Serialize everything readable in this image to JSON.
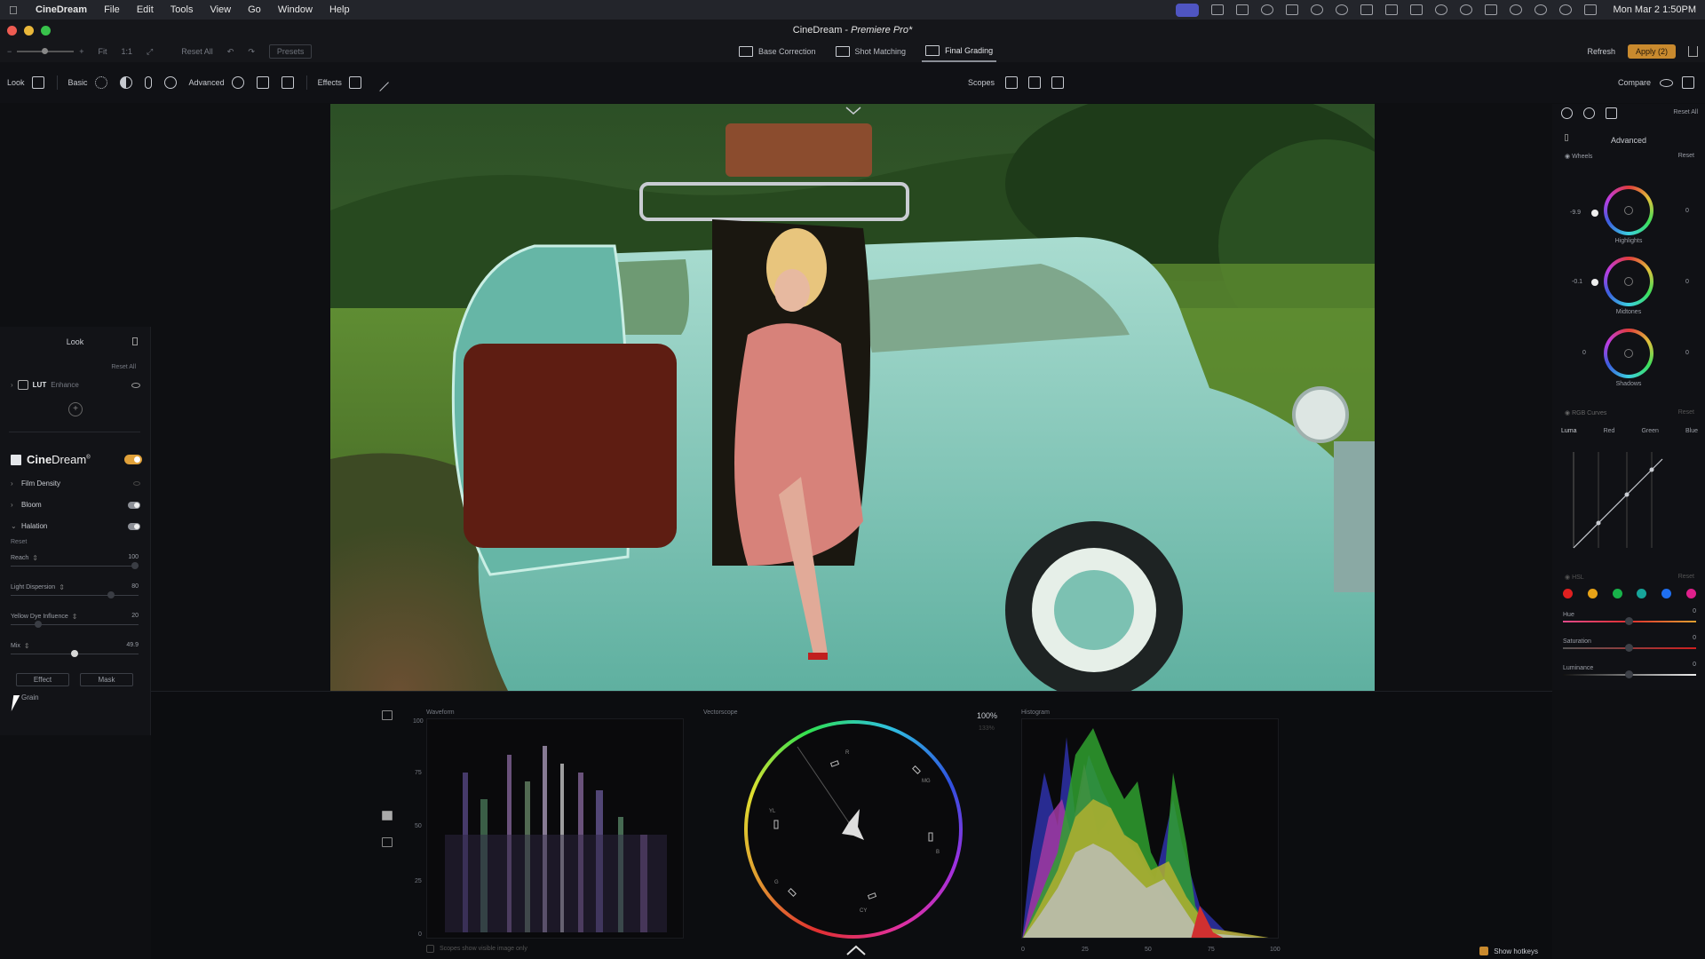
{
  "menubar": {
    "app": "CineDream",
    "items": [
      "File",
      "Edit",
      "Tools",
      "View",
      "Go",
      "Window",
      "Help"
    ],
    "clock": "Mon Mar 2  1:50PM"
  },
  "window": {
    "title_main": "CineDream - ",
    "title_app": "Premiere Pro*"
  },
  "toolbar2": {
    "fit": "Fit",
    "one_to_one": "1:1",
    "reset_all": "Reset All",
    "presets": "Presets",
    "modes": [
      {
        "label": "Base Correction"
      },
      {
        "label": "Shot Matching"
      },
      {
        "label": "Final Grading"
      }
    ],
    "refresh": "Refresh",
    "apply": "Apply (2)"
  },
  "toolbar3": {
    "look": "Look",
    "basic": "Basic",
    "advanced": "Advanced",
    "effects": "Effects",
    "scopes": "Scopes",
    "compare": "Compare"
  },
  "left_panel": {
    "title": "Look",
    "reset_all": "Reset All",
    "lut": {
      "label": "LUT",
      "value": "Enhance"
    },
    "brand_a": "Cine",
    "brand_b": "Dream",
    "brand_mark": "®",
    "effects": [
      {
        "label": "Film Density"
      },
      {
        "label": "Bloom"
      },
      {
        "label": "Halation"
      }
    ],
    "reset": "Reset",
    "sliders": [
      {
        "label": "Reach",
        "value": "100",
        "level": 1.0
      },
      {
        "label": "Light Dispersion",
        "value": "80",
        "level": 0.8
      },
      {
        "label": "Yellow Dye Influence",
        "value": "20",
        "level": 0.2
      },
      {
        "label": "Mix",
        "value": "49.9",
        "level": 0.499
      }
    ],
    "effect_btn": "Effect",
    "mask_btn": "Mask",
    "grain": "Grain"
  },
  "right_panel": {
    "reset_all": "Reset All",
    "advanced": "Advanced",
    "wheels_label": "Wheels",
    "wheels_reset": "Reset",
    "wheels": [
      {
        "label": "Highlights",
        "left": "-9.9",
        "right": "0"
      },
      {
        "label": "Midtones",
        "left": "-0.1",
        "right": "0"
      },
      {
        "label": "Shadows",
        "left": "0",
        "right": "0"
      }
    ],
    "rgb_curves": "RGB Curves",
    "curves_reset": "Reset",
    "curve_tabs": [
      "Luma",
      "Red",
      "Green",
      "Blue"
    ],
    "hsl": "HSL",
    "hsl_reset": "Reset",
    "hsl_colors": [
      "#e02020",
      "#e8a317",
      "#18b34a",
      "#17a59a",
      "#1f6ff0",
      "#e0208c"
    ],
    "hsl_sliders": [
      {
        "label": "Hue",
        "value": "0"
      },
      {
        "label": "Saturation",
        "value": "0"
      },
      {
        "label": "Luminance",
        "value": "0"
      }
    ]
  },
  "scopes": {
    "waveform": "Waveform",
    "vectorscope": "Vectorscope",
    "histogram": "Histogram",
    "percent": "100%",
    "percent2": "133%",
    "wave_ticks": [
      "100",
      "75",
      "50",
      "25",
      "0"
    ],
    "hist_ticks": [
      "0",
      "25",
      "50",
      "75",
      "100"
    ],
    "vec_labels": [
      "R",
      "MG",
      "YL",
      "B",
      "G",
      "CY"
    ],
    "visible_only": "Scopes show visible image only",
    "show_hotkeys": "Show hotkeys"
  }
}
